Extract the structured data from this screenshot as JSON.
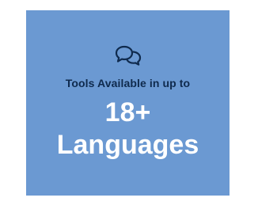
{
  "card": {
    "icon": "chat-bubbles-icon",
    "subtitle": "Tools Available in up to",
    "number": "18+",
    "label": "Languages",
    "background_color": "#6b99d2",
    "text_dark_color": "#0f2a4d",
    "text_light_color": "#ffffff"
  }
}
